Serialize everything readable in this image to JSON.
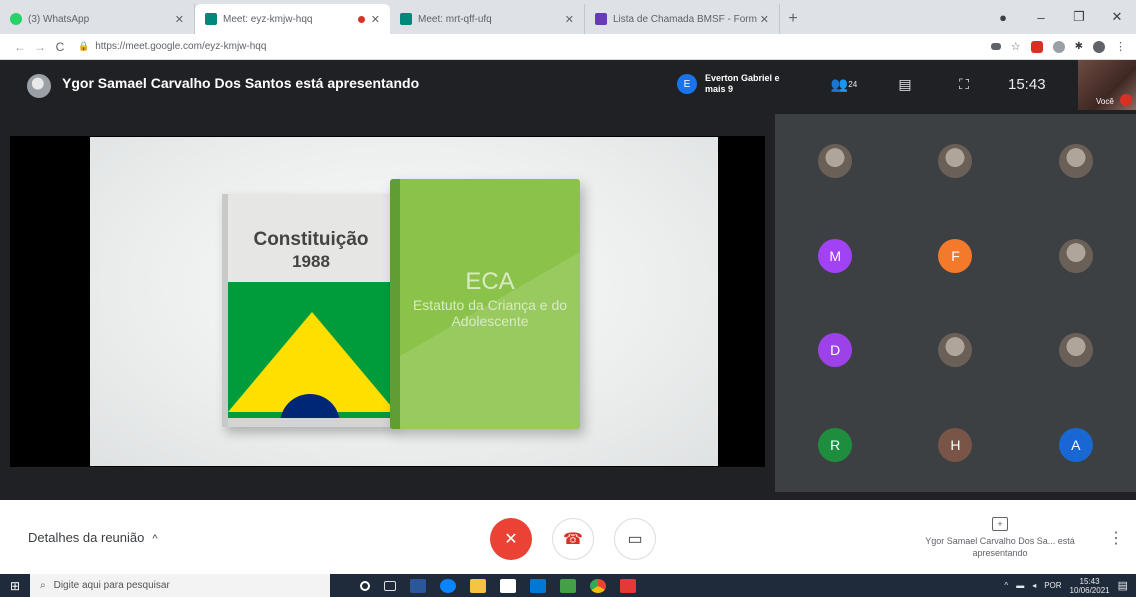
{
  "browser": {
    "tabs": [
      {
        "title": "(3) WhatsApp",
        "favicon_color": "#25d366",
        "active": false,
        "recording": false
      },
      {
        "title": "Meet: eyz-kmjw-hqq",
        "favicon_color": "#00897b",
        "active": true,
        "recording": true
      },
      {
        "title": "Meet: mrt-qff-ufq",
        "favicon_color": "#00897b",
        "active": false,
        "recording": false
      },
      {
        "title": "Lista de Chamada BMSF - Form",
        "favicon_color": "#673ab7",
        "active": false,
        "recording": false
      }
    ],
    "new_tab_symbol": "+",
    "window_controls": [
      "●",
      "–",
      "❐",
      "✕"
    ],
    "url": "https://meet.google.com/eyz-kmjw-hqq"
  },
  "meet": {
    "presenter_title": "Ygor Samael Carvalho Dos Santos está apresentando",
    "participants_chip": {
      "initial": "E",
      "text": "Everton Gabriel e mais 9"
    },
    "participant_count": "24",
    "clock": "15:43",
    "self_label": "Você",
    "slide": {
      "book1_title": "Constituição",
      "book1_year": "1988",
      "book2_title": "ECA",
      "book2_subtitle": "Estatuto da Criança e do Adolescente"
    },
    "tiles": [
      {
        "type": "photo",
        "initial": ""
      },
      {
        "type": "photo",
        "initial": ""
      },
      {
        "type": "photo",
        "initial": ""
      },
      {
        "type": "initial",
        "initial": "M",
        "color": "#a142f4"
      },
      {
        "type": "initial",
        "initial": "F",
        "color": "#f4792b"
      },
      {
        "type": "photo",
        "initial": ""
      },
      {
        "type": "initial",
        "initial": "D",
        "color": "#9c42e8"
      },
      {
        "type": "photo",
        "initial": ""
      },
      {
        "type": "photo",
        "initial": ""
      },
      {
        "type": "initial",
        "initial": "R",
        "color": "#1e8e3e"
      },
      {
        "type": "initial",
        "initial": "H",
        "color": "#795548"
      },
      {
        "type": "initial",
        "initial": "A",
        "color": "#1967d2"
      }
    ]
  },
  "controls": {
    "details_label": "Detalhes da reunião",
    "present_text": "Ygor Samael Carvalho Dos Sa... está apresentando"
  },
  "taskbar": {
    "search_placeholder": "Digite aqui para pesquisar",
    "lang": "POR",
    "time": "15:43",
    "date": "10/06/2021"
  }
}
